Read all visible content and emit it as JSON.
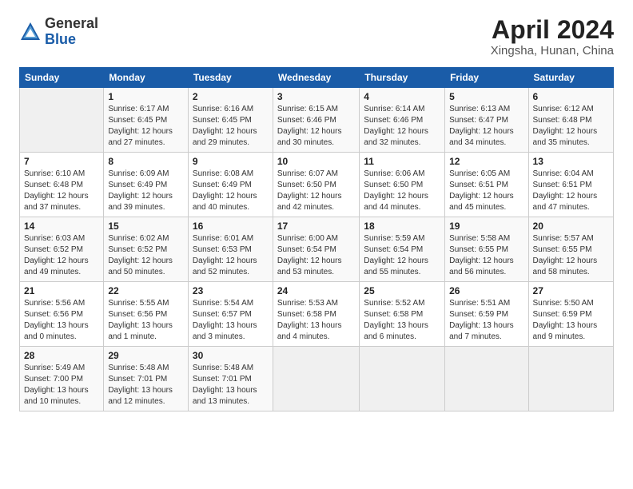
{
  "header": {
    "logo_general": "General",
    "logo_blue": "Blue",
    "title": "April 2024",
    "subtitle": "Xingsha, Hunan, China"
  },
  "weekdays": [
    "Sunday",
    "Monday",
    "Tuesday",
    "Wednesday",
    "Thursday",
    "Friday",
    "Saturday"
  ],
  "weeks": [
    [
      {
        "day": "",
        "empty": true
      },
      {
        "day": "1",
        "sunrise": "6:17 AM",
        "sunset": "6:45 PM",
        "daylight": "12 hours and 27 minutes."
      },
      {
        "day": "2",
        "sunrise": "6:16 AM",
        "sunset": "6:45 PM",
        "daylight": "12 hours and 29 minutes."
      },
      {
        "day": "3",
        "sunrise": "6:15 AM",
        "sunset": "6:46 PM",
        "daylight": "12 hours and 30 minutes."
      },
      {
        "day": "4",
        "sunrise": "6:14 AM",
        "sunset": "6:46 PM",
        "daylight": "12 hours and 32 minutes."
      },
      {
        "day": "5",
        "sunrise": "6:13 AM",
        "sunset": "6:47 PM",
        "daylight": "12 hours and 34 minutes."
      },
      {
        "day": "6",
        "sunrise": "6:12 AM",
        "sunset": "6:48 PM",
        "daylight": "12 hours and 35 minutes."
      }
    ],
    [
      {
        "day": "7",
        "sunrise": "6:10 AM",
        "sunset": "6:48 PM",
        "daylight": "12 hours and 37 minutes."
      },
      {
        "day": "8",
        "sunrise": "6:09 AM",
        "sunset": "6:49 PM",
        "daylight": "12 hours and 39 minutes."
      },
      {
        "day": "9",
        "sunrise": "6:08 AM",
        "sunset": "6:49 PM",
        "daylight": "12 hours and 40 minutes."
      },
      {
        "day": "10",
        "sunrise": "6:07 AM",
        "sunset": "6:50 PM",
        "daylight": "12 hours and 42 minutes."
      },
      {
        "day": "11",
        "sunrise": "6:06 AM",
        "sunset": "6:50 PM",
        "daylight": "12 hours and 44 minutes."
      },
      {
        "day": "12",
        "sunrise": "6:05 AM",
        "sunset": "6:51 PM",
        "daylight": "12 hours and 45 minutes."
      },
      {
        "day": "13",
        "sunrise": "6:04 AM",
        "sunset": "6:51 PM",
        "daylight": "12 hours and 47 minutes."
      }
    ],
    [
      {
        "day": "14",
        "sunrise": "6:03 AM",
        "sunset": "6:52 PM",
        "daylight": "12 hours and 49 minutes."
      },
      {
        "day": "15",
        "sunrise": "6:02 AM",
        "sunset": "6:52 PM",
        "daylight": "12 hours and 50 minutes."
      },
      {
        "day": "16",
        "sunrise": "6:01 AM",
        "sunset": "6:53 PM",
        "daylight": "12 hours and 52 minutes."
      },
      {
        "day": "17",
        "sunrise": "6:00 AM",
        "sunset": "6:54 PM",
        "daylight": "12 hours and 53 minutes."
      },
      {
        "day": "18",
        "sunrise": "5:59 AM",
        "sunset": "6:54 PM",
        "daylight": "12 hours and 55 minutes."
      },
      {
        "day": "19",
        "sunrise": "5:58 AM",
        "sunset": "6:55 PM",
        "daylight": "12 hours and 56 minutes."
      },
      {
        "day": "20",
        "sunrise": "5:57 AM",
        "sunset": "6:55 PM",
        "daylight": "12 hours and 58 minutes."
      }
    ],
    [
      {
        "day": "21",
        "sunrise": "5:56 AM",
        "sunset": "6:56 PM",
        "daylight": "13 hours and 0 minutes."
      },
      {
        "day": "22",
        "sunrise": "5:55 AM",
        "sunset": "6:56 PM",
        "daylight": "13 hours and 1 minute."
      },
      {
        "day": "23",
        "sunrise": "5:54 AM",
        "sunset": "6:57 PM",
        "daylight": "13 hours and 3 minutes."
      },
      {
        "day": "24",
        "sunrise": "5:53 AM",
        "sunset": "6:58 PM",
        "daylight": "13 hours and 4 minutes."
      },
      {
        "day": "25",
        "sunrise": "5:52 AM",
        "sunset": "6:58 PM",
        "daylight": "13 hours and 6 minutes."
      },
      {
        "day": "26",
        "sunrise": "5:51 AM",
        "sunset": "6:59 PM",
        "daylight": "13 hours and 7 minutes."
      },
      {
        "day": "27",
        "sunrise": "5:50 AM",
        "sunset": "6:59 PM",
        "daylight": "13 hours and 9 minutes."
      }
    ],
    [
      {
        "day": "28",
        "sunrise": "5:49 AM",
        "sunset": "7:00 PM",
        "daylight": "13 hours and 10 minutes."
      },
      {
        "day": "29",
        "sunrise": "5:48 AM",
        "sunset": "7:01 PM",
        "daylight": "13 hours and 12 minutes."
      },
      {
        "day": "30",
        "sunrise": "5:48 AM",
        "sunset": "7:01 PM",
        "daylight": "13 hours and 13 minutes."
      },
      {
        "day": "",
        "empty": true
      },
      {
        "day": "",
        "empty": true
      },
      {
        "day": "",
        "empty": true
      },
      {
        "day": "",
        "empty": true
      }
    ]
  ]
}
